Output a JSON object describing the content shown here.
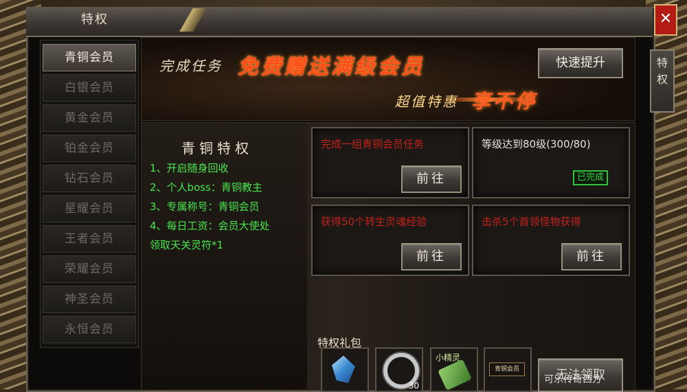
{
  "window": {
    "title": "特权",
    "close_label": "✕",
    "side_tab": "特权"
  },
  "sidebar": {
    "items": [
      {
        "label": "青铜会员",
        "active": true
      },
      {
        "label": "白银会员",
        "active": false
      },
      {
        "label": "黄金会员",
        "active": false
      },
      {
        "label": "铂金会员",
        "active": false
      },
      {
        "label": "钻石会员",
        "active": false
      },
      {
        "label": "星耀会员",
        "active": false
      },
      {
        "label": "王者会员",
        "active": false
      },
      {
        "label": "荣耀会员",
        "active": false
      },
      {
        "label": "神圣会员",
        "active": false
      },
      {
        "label": "永恒会员",
        "active": false
      }
    ]
  },
  "banner": {
    "line1_prefix": "完成任务",
    "line1_highlight": "免费赠送满级会员",
    "line2_prefix": "超值特惠",
    "line2_highlight": "享不停",
    "promote_button": "快速提升"
  },
  "privilege": {
    "title": "青铜特权",
    "lines": [
      "1、开启随身回收",
      "2、个人boss：青铜教主",
      "3、专属称号：青铜会员",
      "4、每日工资：会员大使处",
      "领取天关灵符*1"
    ]
  },
  "tasks": [
    {
      "text": "完成一组青铜会员任务",
      "color": "red",
      "action": "前往"
    },
    {
      "text": "等级达到80级(300/80)",
      "color": "white",
      "status": "已完成"
    },
    {
      "text": "获得50个转生灵魂经验",
      "color": "red",
      "action": "前往"
    },
    {
      "text": "击杀5个首领怪物获得",
      "color": "red",
      "action": "前往"
    }
  ],
  "gifts": {
    "label": "特权礼包",
    "items": [
      {
        "icon": "crystal-gem-icon"
      },
      {
        "icon": "ring-item-icon",
        "count": "30"
      },
      {
        "icon": "leaf-spirit-icon",
        "caption": "小精灵"
      },
      {
        "icon": "bronze-badge-icon",
        "caption": "青铜会员"
      }
    ],
    "claim_button": "无法领取"
  },
  "watermark": "可乐传奇西方"
}
